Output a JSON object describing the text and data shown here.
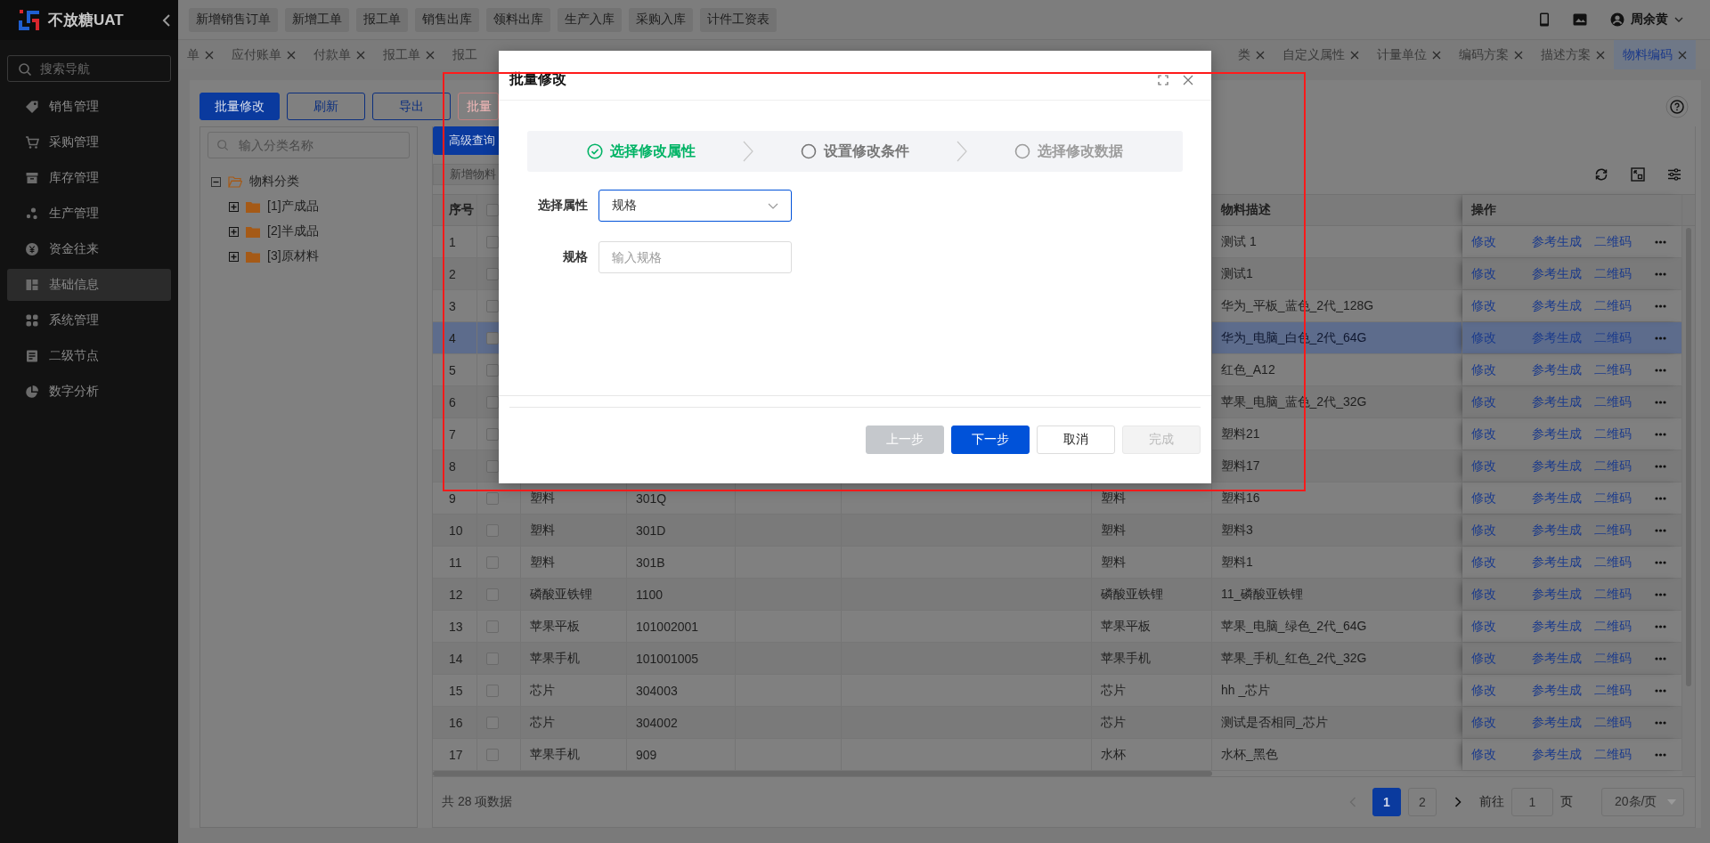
{
  "sidebar": {
    "brand": "不放糖UAT",
    "search": {
      "placeholder": "搜索导航"
    },
    "items": [
      {
        "label": "销售管理",
        "selected": false
      },
      {
        "label": "采购管理",
        "selected": false
      },
      {
        "label": "库存管理",
        "selected": false
      },
      {
        "label": "生产管理",
        "selected": false
      },
      {
        "label": "资金往来",
        "selected": false
      },
      {
        "label": "基础信息",
        "selected": true
      },
      {
        "label": "系统管理",
        "selected": false
      },
      {
        "label": "二级节点",
        "selected": false
      },
      {
        "label": "数字分析",
        "selected": false
      }
    ]
  },
  "topbar": {
    "quick_links": [
      "新增销售订单",
      "新增工单",
      "报工单",
      "销售出库",
      "领料出库",
      "生产入库",
      "采购入库",
      "计件工资表"
    ],
    "user": "周余黄"
  },
  "tabs": {
    "left": [
      {
        "label": "单",
        "closable": true,
        "selected": false
      },
      {
        "label": "应付账单",
        "closable": true,
        "selected": false
      },
      {
        "label": "付款单",
        "closable": true,
        "selected": false
      },
      {
        "label": "报工单",
        "closable": true,
        "selected": false
      },
      {
        "label": "报工",
        "closable": false,
        "selected": false
      }
    ],
    "right": [
      {
        "label": "类",
        "closable": true,
        "selected": false
      },
      {
        "label": "自定义属性",
        "closable": true,
        "selected": false
      },
      {
        "label": "计量单位",
        "closable": true,
        "selected": false
      },
      {
        "label": "编码方案",
        "closable": true,
        "selected": false
      },
      {
        "label": "描述方案",
        "closable": true,
        "selected": false
      },
      {
        "label": "物料编码",
        "closable": true,
        "selected": true
      }
    ]
  },
  "toolbar": {
    "buttons": [
      {
        "label": "批量修改",
        "kind": "primary"
      },
      {
        "label": "刷新",
        "kind": "outline"
      },
      {
        "label": "导出",
        "kind": "outline"
      },
      {
        "label": "批量",
        "kind": "danger"
      }
    ]
  },
  "tree": {
    "search": {
      "placeholder": "输入分类名称"
    },
    "nodes": [
      {
        "label": "物料分类",
        "expanded": true,
        "children": [
          {
            "label": "[1]产成品",
            "expanded": false
          },
          {
            "label": "[2]半成品",
            "expanded": false
          },
          {
            "label": "[3]原材料",
            "expanded": false
          }
        ]
      }
    ]
  },
  "table": {
    "query_button": "高级查询",
    "add_button": {
      "label": "新增物料",
      "disabled": true
    },
    "columns": {
      "index": "序号",
      "description": "物料描述",
      "actions": "操作"
    },
    "all_checked": false,
    "rows": [
      {
        "index": "1",
        "checked": false,
        "selected": false,
        "description": "测试 1",
        "actions": [
          "修改",
          "参考生成",
          "二维码"
        ]
      },
      {
        "index": "2",
        "checked": false,
        "selected": false,
        "description": "测试1",
        "actions": [
          "修改",
          "参考生成",
          "二维码"
        ]
      },
      {
        "index": "3",
        "checked": false,
        "selected": false,
        "description": "华为_平板_蓝色_2代_128G",
        "actions": [
          "修改",
          "参考生成",
          "二维码"
        ]
      },
      {
        "index": "4",
        "checked": false,
        "selected": true,
        "description": "华为_电脑_白色_2代_64G",
        "actions": [
          "修改",
          "参考生成",
          "二维码"
        ]
      },
      {
        "index": "5",
        "checked": false,
        "selected": false,
        "description": "红色_A12",
        "actions": [
          "修改",
          "参考生成",
          "二维码"
        ]
      },
      {
        "index": "6",
        "checked": false,
        "selected": false,
        "description": "苹果_电脑_蓝色_2代_32G",
        "actions": [
          "修改",
          "参考生成",
          "二维码"
        ]
      },
      {
        "index": "7",
        "checked": false,
        "selected": false,
        "description": "塑料21",
        "actions": [
          "修改",
          "参考生成",
          "二维码"
        ]
      },
      {
        "index": "8",
        "checked": false,
        "selected": false,
        "description": "塑料17",
        "actions": [
          "修改",
          "参考生成",
          "二维码"
        ]
      },
      {
        "index": "9",
        "checked": false,
        "selected": false,
        "column_3": "塑料",
        "column_4": "301Q",
        "column_7": "塑料",
        "description": "塑料16",
        "actions": [
          "修改",
          "参考生成",
          "二维码"
        ]
      },
      {
        "index": "10",
        "checked": false,
        "selected": false,
        "column_3": "塑料",
        "column_4": "301D",
        "column_7": "塑料",
        "description": "塑料3",
        "actions": [
          "修改",
          "参考生成",
          "二维码"
        ]
      },
      {
        "index": "11",
        "checked": false,
        "selected": false,
        "column_3": "塑料",
        "column_4": "301B",
        "column_7": "塑料",
        "description": "塑料1",
        "actions": [
          "修改",
          "参考生成",
          "二维码"
        ]
      },
      {
        "index": "12",
        "checked": false,
        "selected": false,
        "column_3": "磷酸亚铁锂",
        "column_4": "1100",
        "column_7": "磷酸亚铁锂",
        "description": "11_磷酸亚铁锂",
        "actions": [
          "修改",
          "参考生成",
          "二维码"
        ]
      },
      {
        "index": "13",
        "checked": false,
        "selected": false,
        "column_3": "苹果平板",
        "column_4": "101002001",
        "column_7": "苹果平板",
        "description": "苹果_电脑_绿色_2代_64G",
        "actions": [
          "修改",
          "参考生成",
          "二维码"
        ]
      },
      {
        "index": "14",
        "checked": false,
        "selected": false,
        "column_3": "苹果手机",
        "column_4": "101001005",
        "column_7": "苹果手机",
        "description": "苹果_手机_红色_2代_32G",
        "actions": [
          "修改",
          "参考生成",
          "二维码"
        ]
      },
      {
        "index": "15",
        "checked": false,
        "selected": false,
        "column_3": "芯片",
        "column_4": "304003",
        "column_7": "芯片",
        "description": "hh _芯片",
        "actions": [
          "修改",
          "参考生成",
          "二维码"
        ]
      },
      {
        "index": "16",
        "checked": false,
        "selected": false,
        "column_3": "芯片",
        "column_4": "304002",
        "column_7": "芯片",
        "description": "测试是否相同_芯片",
        "actions": [
          "修改",
          "参考生成",
          "二维码"
        ]
      },
      {
        "index": "17",
        "checked": false,
        "selected": false,
        "column_3": "苹果手机",
        "column_4": "909",
        "column_7": "水杯",
        "description": "水杯_黑色",
        "actions": [
          "修改",
          "参考生成",
          "二维码"
        ]
      }
    ],
    "total": "共 28 项数据",
    "pagination": {
      "prev_disabled": true,
      "pages": [
        {
          "label": "1",
          "selected": true
        },
        {
          "label": "2",
          "selected": false
        }
      ],
      "goto_label": "前往",
      "goto_value": "1",
      "goto_unit": "页",
      "page_size": "20条/页"
    }
  },
  "dialog": {
    "title": "批量修改",
    "steps": [
      {
        "label": "选择修改属性",
        "done": true,
        "current": false
      },
      {
        "label": "设置修改条件",
        "done": false,
        "current": true
      },
      {
        "label": "选择修改数据",
        "done": false,
        "current": false
      }
    ],
    "fields": [
      {
        "label": "选择属性",
        "kind": "select",
        "value": "规格",
        "focused": true
      },
      {
        "label": "规格",
        "kind": "input",
        "placeholder": "输入规格",
        "focused": false
      }
    ],
    "buttons": [
      {
        "label": "上一步",
        "kind": "secondary",
        "disabled": true
      },
      {
        "label": "下一步",
        "kind": "primary",
        "disabled": false
      },
      {
        "label": "取消",
        "kind": "default",
        "disabled": false
      },
      {
        "label": "完成",
        "kind": "default",
        "disabled": true
      }
    ]
  }
}
